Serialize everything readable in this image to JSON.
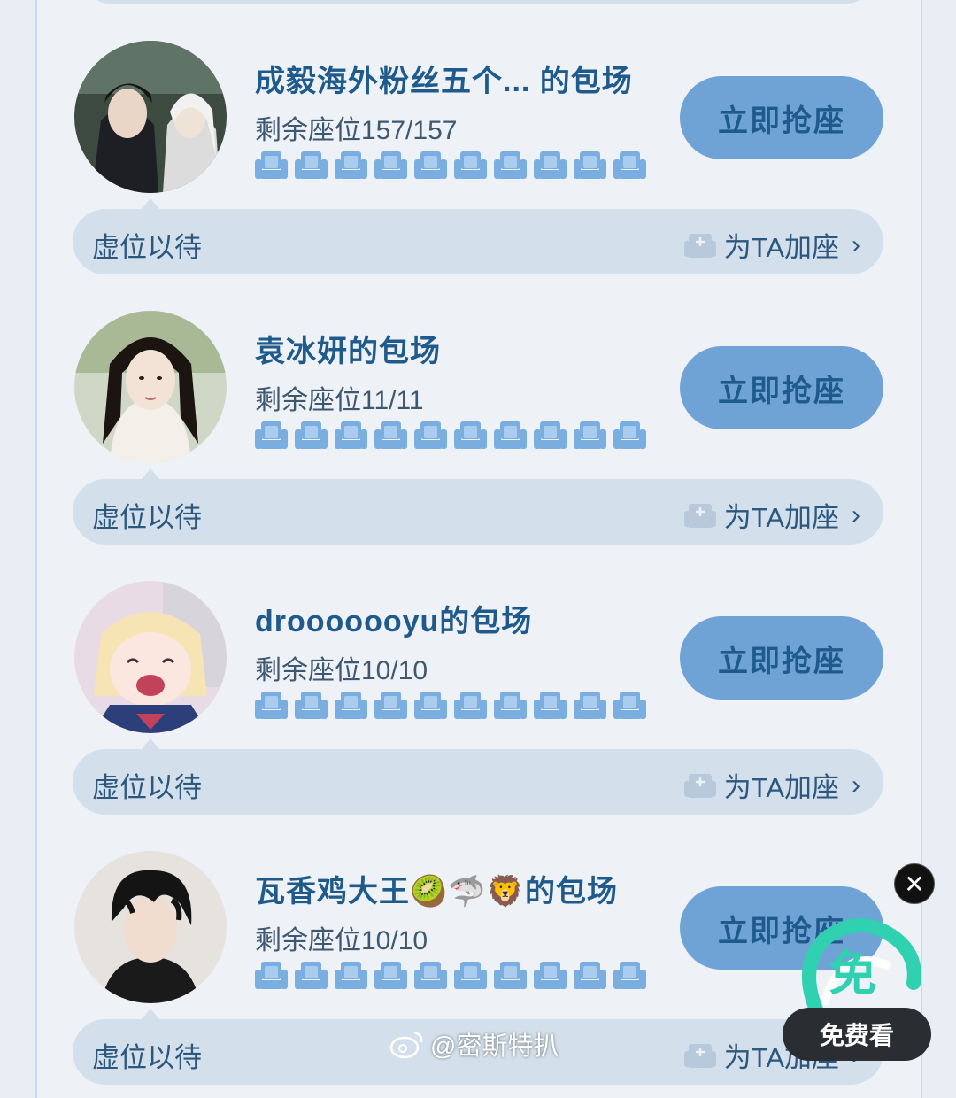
{
  "colors": {
    "accent": "#6fa3d6",
    "title": "#1e5a8c",
    "bar": "#d3e0ec",
    "seat": "#7aaee0"
  },
  "cards": [
    {
      "title": "成毅海外粉丝五个... 的包场",
      "remaining": "剩余座位157/157",
      "seat_count": 10,
      "grab_label": "立即抢座",
      "bar_label": "虚位以待",
      "add_label": "为TA加座",
      "avatar": "avatar-two-men"
    },
    {
      "title": "袁冰妍的包场",
      "remaining": "剩余座位11/11",
      "seat_count": 10,
      "grab_label": "立即抢座",
      "bar_label": "虚位以待",
      "add_label": "为TA加座",
      "avatar": "avatar-woman"
    },
    {
      "title": "drooooooyu的包场",
      "remaining": "剩余座位10/10",
      "seat_count": 10,
      "grab_label": "立即抢座",
      "bar_label": "虚位以待",
      "add_label": "为TA加座",
      "avatar": "avatar-anime"
    },
    {
      "title": "瓦香鸡大王🥝🦈🦁的包场",
      "remaining": "剩余座位10/10",
      "seat_count": 10,
      "grab_label": "立即抢座",
      "bar_label": "虚位以待",
      "add_label": "为TA加座",
      "avatar": "avatar-man"
    }
  ],
  "overlay": {
    "free_label": "免费看",
    "logo_char": "免",
    "close_icon": "close-icon",
    "watermark": "@密斯特扒"
  }
}
